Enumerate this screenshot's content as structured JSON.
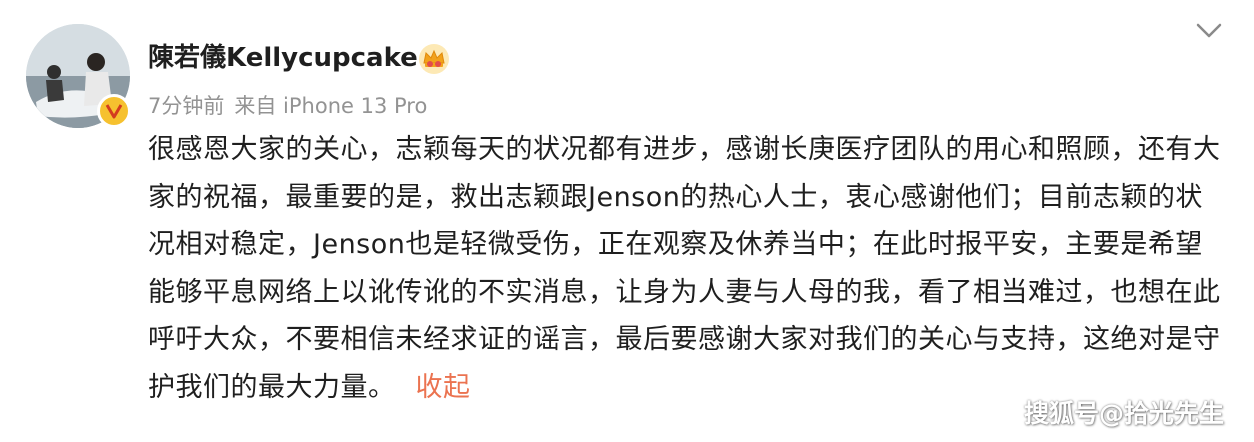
{
  "post": {
    "author": {
      "name": "陳若儀Kellycupcake",
      "avatar_icon": "user-avatar-photo",
      "verified_icon": "verified-badge-icon",
      "member_icon": "crown-icon"
    },
    "meta": {
      "time": "7分钟前",
      "source": "来自 iPhone 13 Pro"
    },
    "menu_icon": "chevron-down-icon",
    "content_text": "很感恩大家的关心，志颖每天的状况都有进步，感谢长庚医疗团队的用心和照顾，还有大家的祝福，最重要的是，救出志颖跟Jenson的热心人士，衷心感谢他们；目前志颖的状况相对稳定，Jenson也是轻微受伤，正在观察及休养当中；在此时报平安，主要是希望能够平息网络上以讹传讹的不实消息，让身为人妻与人母的我，看了相当难过，也想在此呼吁大众，不要相信未经求证的谣言，最后要感谢大家对我们的关心与支持，这绝对是守护我们的最大力量。",
    "collapse_label": "收起"
  },
  "watermark": "搜狐号@拾光先生",
  "colors": {
    "text": "#1f1f1f",
    "meta": "#939393",
    "link": "#eb7350",
    "verified": "#f6c12f"
  }
}
